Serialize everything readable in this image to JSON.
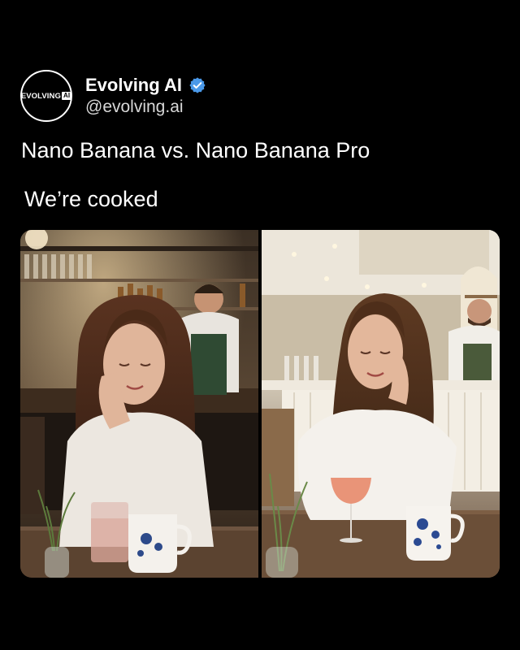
{
  "account": {
    "avatar_text": "EVOLVING",
    "avatar_badge": "AI",
    "display_name": "Evolving AI",
    "handle": "@evolving.ai",
    "verified": true,
    "verified_color": "#4a99e9"
  },
  "post": {
    "title": "Nano Banana vs. Nano Banana Pro",
    "caption": "We’re cooked"
  },
  "media": {
    "layout": "side-by-side comparison",
    "images": [
      {
        "name": "nano-banana-result",
        "scene": "woman smiling at cafe table, bartender behind bar"
      },
      {
        "name": "nano-banana-pro-result",
        "scene": "woman smiling at cafe table, bartender behind bar"
      }
    ]
  },
  "icons": [
    "verified-check-icon"
  ]
}
